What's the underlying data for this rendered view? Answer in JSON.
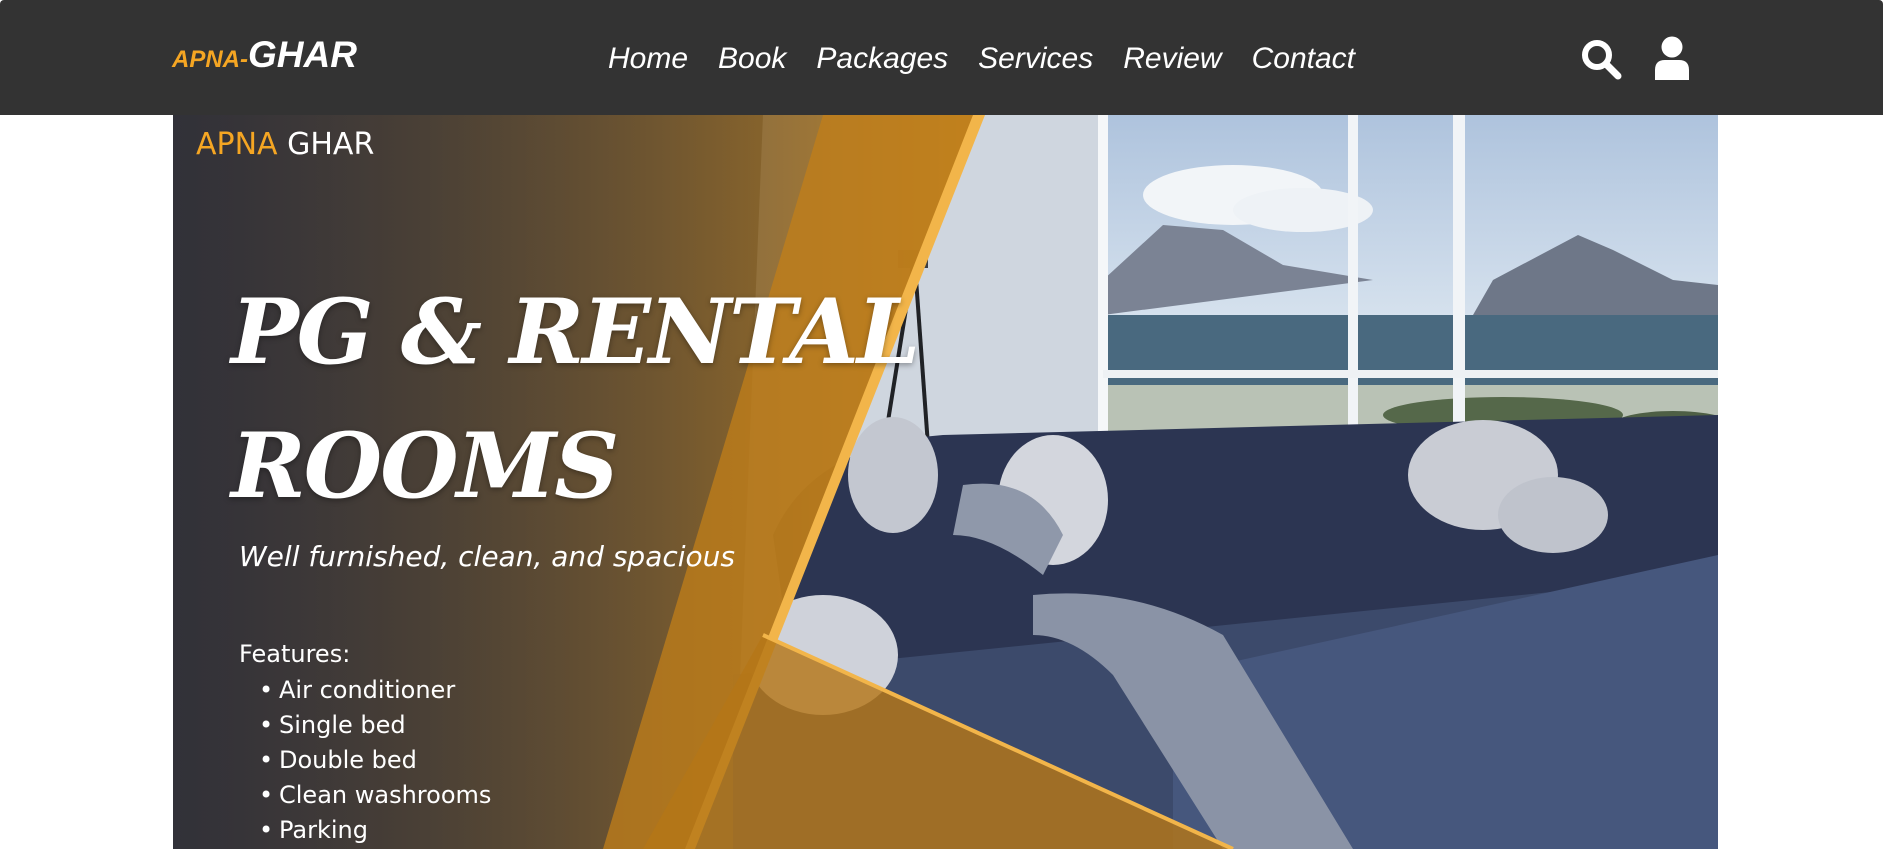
{
  "header": {
    "logo_prefix": "APNA-",
    "logo_main": "GHAR",
    "nav": [
      "Home",
      "Book",
      "Packages",
      "Services",
      "Review",
      "Contact"
    ],
    "icons": [
      "search-icon",
      "user-icon"
    ]
  },
  "hero": {
    "brand_part1": "APNA",
    "brand_part2": "GHAR",
    "title_line1": "PG & RENTAL",
    "title_line2": "ROOMS",
    "subtitle": "Well furnished, clean, and spacious",
    "features_heading": "Features:",
    "features": [
      "Air conditioner",
      "Single bed",
      "Double bed",
      "Clean washrooms",
      "Parking"
    ]
  },
  "colors": {
    "topbar": "#333333",
    "accent": "#f5a623",
    "text": "#ffffff"
  }
}
